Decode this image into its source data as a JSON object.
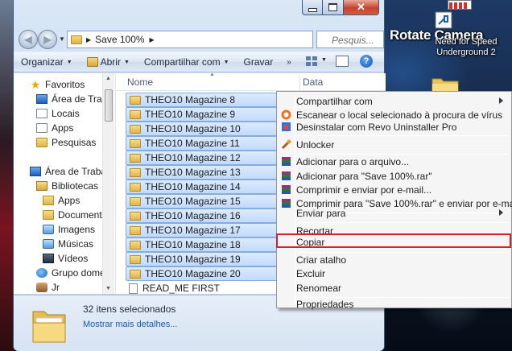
{
  "desktop": {
    "rotate_camera_label": "Rotate Camera",
    "nfs_label_line1": "Need for Speed",
    "nfs_label_line2": "Underground 2"
  },
  "window": {
    "address_path": "Save 100%",
    "search_placeholder": "Pesquis...",
    "toolbar": {
      "organize": "Organizar",
      "open": "Abrir",
      "share": "Compartilhar com",
      "burn": "Gravar",
      "more": "»"
    },
    "nav": {
      "favorites": "Favoritos",
      "desktop": "Área de Trabal",
      "recent": "Locais",
      "apps": "Apps",
      "searches": "Pesquisas",
      "desktop2": "Área de Trabalh",
      "libraries": "Bibliotecas",
      "lib_apps": "Apps",
      "documents": "Documentos",
      "images": "Imagens",
      "music": "Músicas",
      "videos": "Vídeos",
      "homegroup": "Grupo domést",
      "user": "Jr"
    },
    "columns": {
      "name": "Nome",
      "date": "Data"
    },
    "files": [
      "THEO10 Magazine 8",
      "THEO10 Magazine 9",
      "THEO10 Magazine 10",
      "THEO10 Magazine 11",
      "THEO10 Magazine 12",
      "THEO10 Magazine 13",
      "THEO10 Magazine 14",
      "THEO10 Magazine 15",
      "THEO10 Magazine 16",
      "THEO10 Magazine 17",
      "THEO10 Magazine 18",
      "THEO10 Magazine 19",
      "THEO10 Magazine 20",
      "READ_ME FIRST"
    ],
    "details": {
      "count": "32 itens selecionados",
      "more": "Mostrar mais detalhes..."
    }
  },
  "context_menu": {
    "share_with": "Compartilhar com",
    "scan": "Escanear o local selecionado à procura de vírus",
    "uninstall": "Desinstalar com Revo Uninstaller Pro",
    "unlocker": "Unlocker",
    "add_archive": "Adicionar para o arquivo...",
    "add_rar": "Adicionar para \"Save 100%.rar\"",
    "compress_email": "Comprimir e enviar por e-mail...",
    "compress_rar_email": "Comprimir para \"Save 100%.rar\" e enviar por e-mail",
    "send_to": "Enviar para",
    "cut": "Recortar",
    "copy": "Copiar",
    "shortcut": "Criar atalho",
    "delete": "Excluir",
    "rename": "Renomear",
    "properties": "Propriedades"
  },
  "colors": {
    "selection": "#c1dbfc",
    "highlight_border": "#d4202c"
  }
}
